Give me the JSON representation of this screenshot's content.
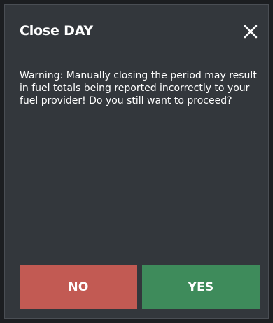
{
  "dialog": {
    "title": "Close DAY",
    "close_icon": "close-icon",
    "message": "Warning: Manually closing the period may result in fuel totals being reported incorrectly to your fuel provider! Do you still want to proceed?",
    "no_label": "NO",
    "yes_label": "YES"
  },
  "colors": {
    "dialog_background": "#33373c",
    "no_button": "#c25a53",
    "yes_button": "#3e8b5b",
    "text": "#ffffff"
  }
}
